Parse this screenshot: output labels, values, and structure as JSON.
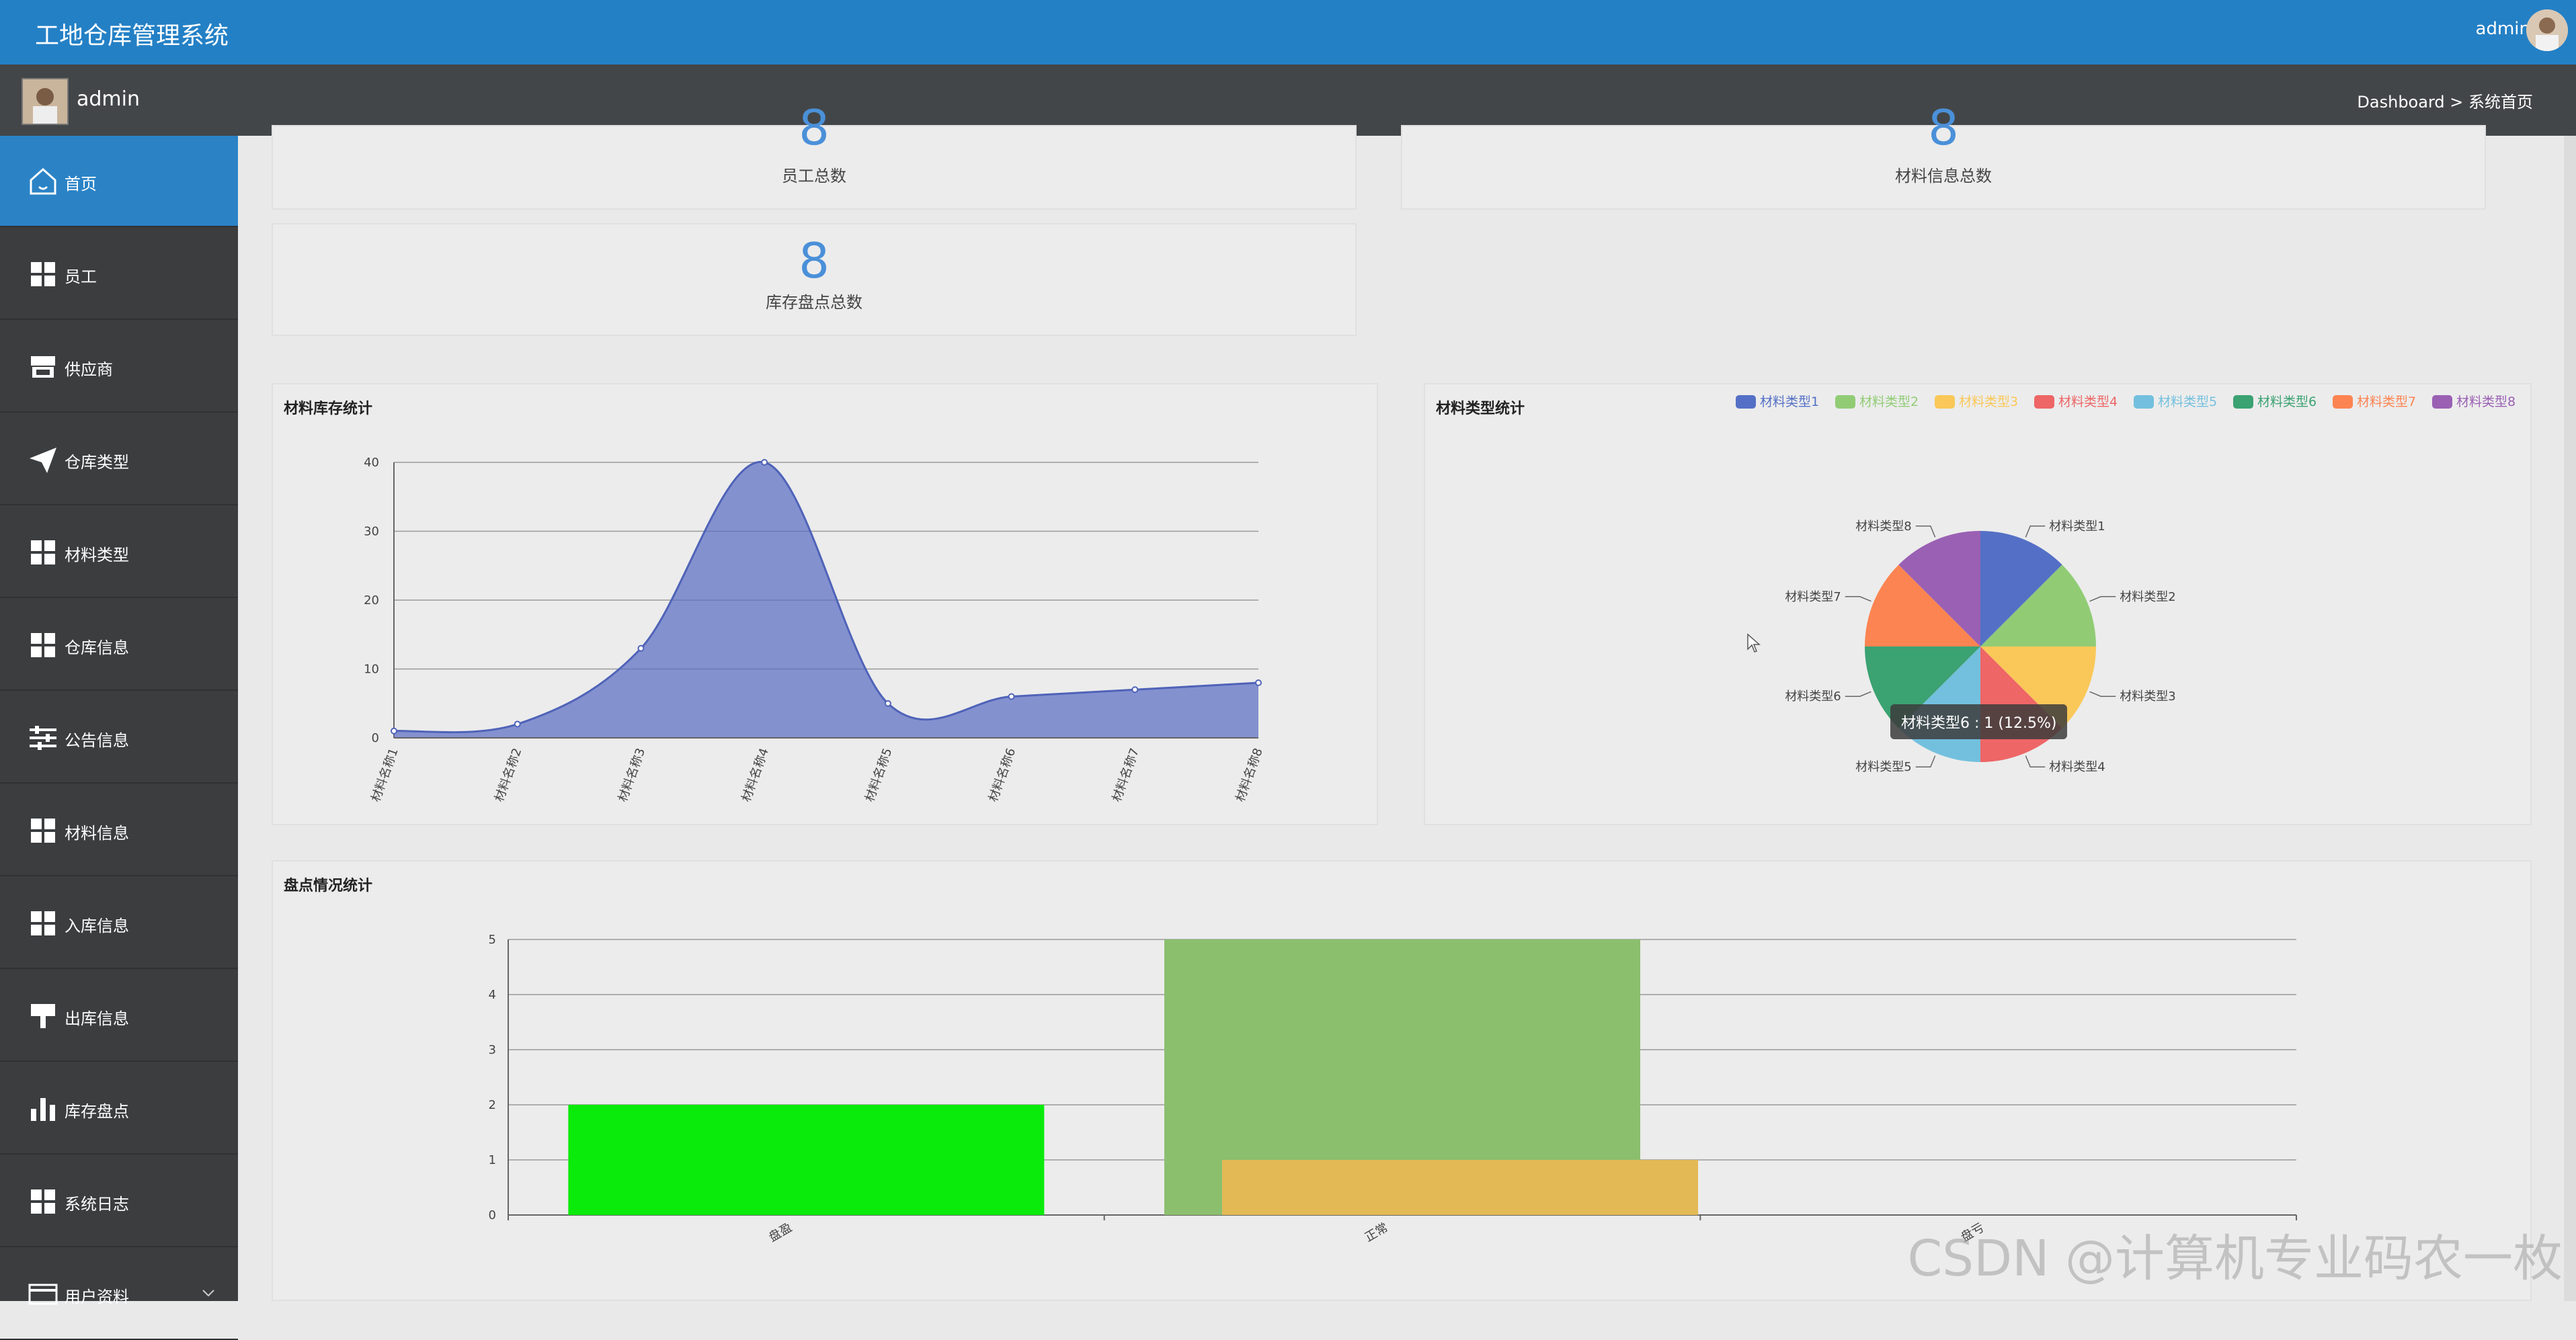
{
  "app": {
    "title": "工地仓库管理系统",
    "user": "admin"
  },
  "subheader": {
    "username": "admin",
    "breadcrumb": "Dashboard > 系统首页"
  },
  "sidebar": {
    "items": [
      {
        "label": "首页",
        "icon": "home-icon"
      },
      {
        "label": "员工",
        "icon": "grid-icon"
      },
      {
        "label": "供应商",
        "icon": "store-icon"
      },
      {
        "label": "仓库类型",
        "icon": "send-icon"
      },
      {
        "label": "材料类型",
        "icon": "grid-icon"
      },
      {
        "label": "仓库信息",
        "icon": "grid-icon"
      },
      {
        "label": "公告信息",
        "icon": "sliders-icon"
      },
      {
        "label": "材料信息",
        "icon": "grid-icon"
      },
      {
        "label": "入库信息",
        "icon": "grid-icon"
      },
      {
        "label": "出库信息",
        "icon": "brush-icon"
      },
      {
        "label": "库存盘点",
        "icon": "bar-chart-icon"
      },
      {
        "label": "系统日志",
        "icon": "grid-icon"
      },
      {
        "label": "用户资料",
        "icon": "card-icon"
      }
    ]
  },
  "stats": {
    "employees": {
      "value": "8",
      "label": "员工总数"
    },
    "materials": {
      "value": "8",
      "label": "材料信息总数"
    },
    "inventory": {
      "value": "8",
      "label": "库存盘点总数"
    }
  },
  "chart_data": [
    {
      "type": "area",
      "title": "材料库存统计",
      "categories": [
        "材料名称1",
        "材料名称2",
        "材料名称3",
        "材料名称4",
        "材料名称5",
        "材料名称6",
        "材料名称7",
        "材料名称8"
      ],
      "values": [
        1,
        2,
        13,
        40,
        5,
        6,
        7,
        8
      ],
      "ylim": [
        0,
        40
      ],
      "yticks": [
        0,
        10,
        20,
        30,
        40
      ],
      "color": "#5b6ec4"
    },
    {
      "type": "pie",
      "title": "材料类型统计",
      "labels": [
        "材料类型1",
        "材料类型2",
        "材料类型3",
        "材料类型4",
        "材料类型5",
        "材料类型6",
        "材料类型7",
        "材料类型8"
      ],
      "values": [
        1,
        1,
        1,
        1,
        1,
        1,
        1,
        1
      ],
      "colors": [
        "#5470c6",
        "#91cc75",
        "#fac858",
        "#ee6666",
        "#73c0de",
        "#3ba272",
        "#fc8452",
        "#9a60b4"
      ],
      "tooltip": "材料类型6 : 1 (12.5%)",
      "legend_position": "top-right"
    },
    {
      "type": "bar",
      "title": "盘点情况统计",
      "categories": [
        "盘盈",
        "正常",
        "盘亏"
      ],
      "series": [
        {
          "values": [
            2,
            5,
            0
          ],
          "colors": [
            "#0beb0b",
            "#8bbf6e",
            "#8bbf6e"
          ]
        },
        {
          "values": [
            0,
            1,
            0
          ],
          "colors": [
            "#e3b955",
            "#e3b955",
            "#e3b955"
          ]
        }
      ],
      "ylim": [
        0,
        5
      ],
      "yticks": [
        0,
        1,
        2,
        3,
        4,
        5
      ]
    }
  ],
  "watermark": "CSDN @计算机专业码农一枚"
}
